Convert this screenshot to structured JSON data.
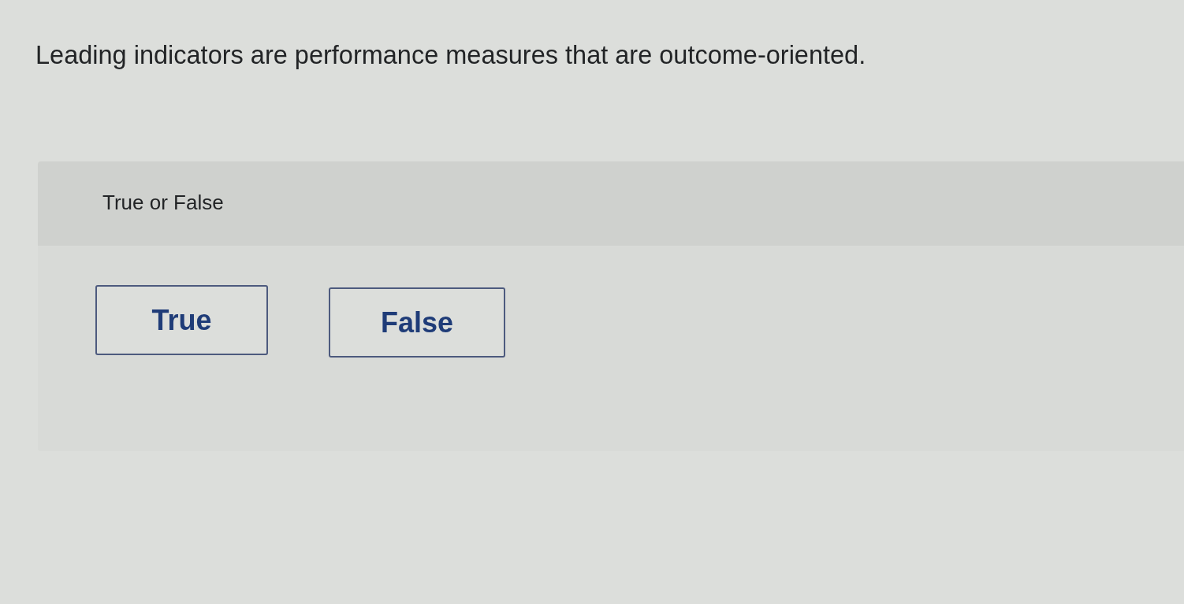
{
  "question": {
    "text": "Leading indicators are performance measures that are outcome-oriented."
  },
  "answer_panel": {
    "prompt": "True or False",
    "choices": [
      {
        "label": "True",
        "selected": false
      },
      {
        "label": "False",
        "selected": false
      }
    ]
  }
}
